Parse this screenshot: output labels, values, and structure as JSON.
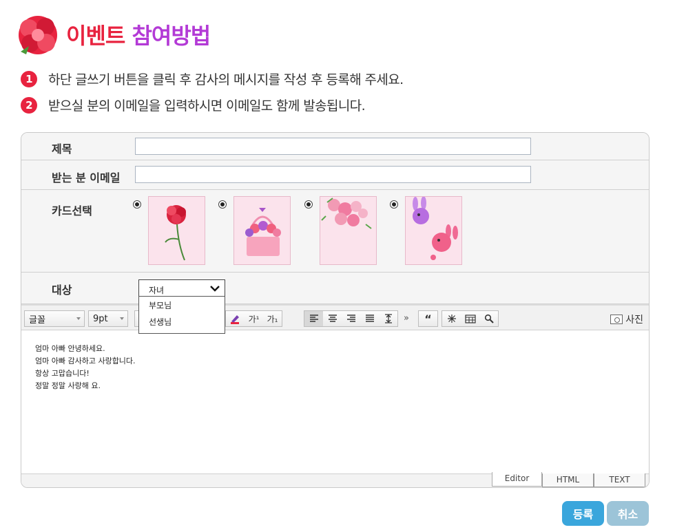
{
  "header": {
    "title_part1": "이벤트",
    "title_part2": "참여방법"
  },
  "steps": [
    {
      "num": "1",
      "text": "하단 글쓰기 버튼을 클릭 후 감사의 메시지를 작성 후 등록해 주세요."
    },
    {
      "num": "2",
      "text": "받으실 분의 이메일을 입력하시면 이메일도 함께 발송됩니다."
    }
  ],
  "form": {
    "title_label": "제목",
    "title_value": "",
    "email_label": "받는 분 이메일",
    "email_value": "",
    "card_label": "카드선택",
    "cards": [
      "carnation-card",
      "flower-basket-card",
      "bouquet-card",
      "bunny-card"
    ],
    "target_label": "대상",
    "target_selected": "자녀",
    "target_options": [
      "부모님",
      "선생님"
    ]
  },
  "toolbar": {
    "font": "글꼴",
    "size": "9pt",
    "superscript": "가¹",
    "subscript": "가₁",
    "more": "»",
    "quote": "“",
    "photo": "사진"
  },
  "editor": {
    "lines": [
      "엄마 아빠 안녕하세요.",
      "엄마 아빠 감사하고 사랑합니다.",
      "항상 고맙습니다!",
      "정말 정말 사랑해 요."
    ],
    "tabs": [
      "Editor",
      "HTML",
      "TEXT"
    ]
  },
  "buttons": {
    "submit": "등록",
    "cancel": "취소"
  },
  "colors": {
    "accent_red": "#e8233f",
    "accent_purple": "#b33ad6",
    "submit_blue": "#3aa6dc",
    "cancel_blue": "#9cc4d8"
  }
}
